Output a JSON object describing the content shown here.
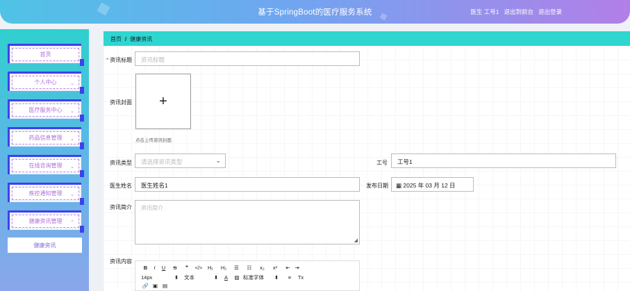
{
  "header": {
    "title": "基于SpringBoot的医疗服务系统",
    "user": "医生 工号1",
    "back_to_admin": "退出到前台",
    "logout": "退出登录"
  },
  "sidebar": {
    "items": [
      {
        "label": "首页",
        "has_chevron": false
      },
      {
        "label": "个人中心",
        "has_chevron": true
      },
      {
        "label": "医疗服务中心",
        "has_chevron": true
      },
      {
        "label": "药品信息管理",
        "has_chevron": true
      },
      {
        "label": "在线咨询管理",
        "has_chevron": true
      },
      {
        "label": "疾控通知管理",
        "has_chevron": true
      },
      {
        "label": "健康资讯管理",
        "has_chevron": true,
        "expanded": true
      }
    ],
    "submenu": "健康资讯"
  },
  "breadcrumb": {
    "home": "首页",
    "sep": "/",
    "current": "健康资讯"
  },
  "form": {
    "title_label": "资讯标题",
    "title_placeholder": "资讯标题",
    "cover_label": "资讯封面",
    "cover_plus": "+",
    "cover_hint": "点击上传资讯封面",
    "type_label": "资讯类型",
    "type_placeholder": "请选择资讯类型",
    "job_label": "工号",
    "job_value": "工号1",
    "doctor_label": "医生姓名",
    "doctor_value": "医生姓名1",
    "date_label": "发布日期",
    "date_value": "2025 年 03 月 12 日",
    "intro_label": "资讯简介",
    "intro_placeholder": "资讯简介",
    "content_label": "资讯内容"
  },
  "editor": {
    "row1": [
      "B",
      "I",
      "U",
      "S",
      "❞",
      "</>",
      "H₁",
      "H₂",
      "☰",
      "☷",
      "x₂",
      "x²",
      "⇤",
      "⇥"
    ],
    "row2": [
      "14px",
      "⬍",
      "文本",
      "⬍",
      "A",
      "▨",
      "标准字体",
      "⬍",
      "≡",
      "Tx"
    ],
    "row3": [
      "🔗",
      "▣",
      "▤"
    ]
  },
  "colors": {
    "accent": "#2ed6cf",
    "menu_border": "#3d42e8",
    "menu_text": "#b06fd6"
  }
}
